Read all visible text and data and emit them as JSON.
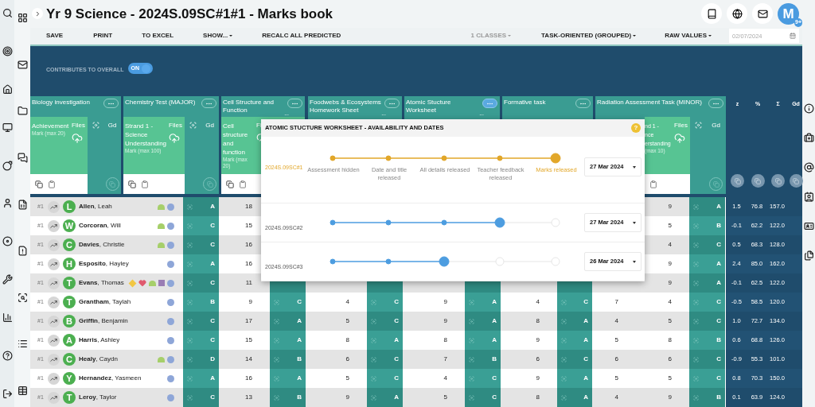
{
  "title": "Yr 9 Science - 2024S.09SC#1#1 - Marks book",
  "avatar": {
    "letter": "M",
    "badge": "9+"
  },
  "toolbar": {
    "actions": [
      {
        "label": "SAVE",
        "kind": "button"
      },
      {
        "label": "PRINT",
        "kind": "button"
      },
      {
        "label": "TO EXCEL",
        "kind": "button"
      },
      {
        "label": "SHOW...",
        "kind": "dropdown"
      },
      {
        "label": "RECALC ALL PREDICTED",
        "kind": "button"
      }
    ],
    "options": [
      {
        "label": "1 CLASSES",
        "disabled": true
      },
      {
        "label": "TASK-ORIENTED (GROUPED)",
        "disabled": false
      },
      {
        "label": "RAW VALUES",
        "disabled": false
      }
    ],
    "date_field": "02/07/2024"
  },
  "contributes": {
    "label": "CONTRIBUTES TO OVERALL",
    "toggle": "ON",
    "on": true
  },
  "tasks": [
    {
      "title": "Biology investigation",
      "menu_selected": false,
      "sub": {
        "strand": "Achievement",
        "max": "Mark (max 20)",
        "files": "Files",
        "grade": "Gd"
      }
    },
    {
      "title": "Chemistry Test (MAJOR)",
      "menu_selected": false,
      "sub": {
        "strand": "Strand 1 - Science Understanding",
        "max": "Mark (max 100)",
        "files": "Files",
        "grade": "Gd"
      }
    },
    {
      "title": "Cell Structure and Function",
      "more": "...",
      "menu_selected": false,
      "sub": {
        "strand": "Cell structure and function",
        "max": "Mark (max 20)",
        "files": "Fi"
      }
    },
    {
      "title": "Foodwebs & Ecosystems Homework Sheet",
      "more": "...",
      "menu_selected": false
    },
    {
      "title": "Atomic Stucture Worksheet",
      "more": "...",
      "menu_selected": true
    },
    {
      "title": "Formative task",
      "menu_selected": false
    },
    {
      "title": "Radiation Assessment Task (MINOR)",
      "menu_selected": false,
      "sub": {
        "cut": true,
        "strand": "nd 1 -\nnce\nerstanding",
        "max": "(max 10)",
        "files": "Files",
        "grade": "Gd"
      }
    }
  ],
  "summary_headers": [
    "z",
    "%",
    "Σ",
    "Gd"
  ],
  "body_columns": [
    {
      "kind": "grade"
    },
    {
      "kind": "mark"
    },
    {
      "kind": "grade"
    },
    {
      "kind": "mark"
    },
    {
      "kind": "grade"
    },
    {
      "kind": "mark"
    },
    {
      "kind": "grade"
    },
    {
      "kind": "mark"
    },
    {
      "kind": "grade"
    },
    {
      "kind": "mark"
    },
    {
      "kind": "mark"
    },
    {
      "kind": "grade"
    }
  ],
  "students": [
    {
      "rank": "#1",
      "initial": "L",
      "name": "**Allen**, Leah",
      "tags": [
        {
          "kind": "pill",
          "color": "#a6cf6a"
        },
        {
          "kind": "dot",
          "color": "#8ea6d8"
        }
      ],
      "cells": [
        "A",
        "18",
        null,
        null,
        null,
        null,
        null,
        null,
        null,
        null,
        "9",
        "A"
      ],
      "summary": [
        "1.5",
        "76.8",
        "157.0"
      ]
    },
    {
      "rank": "#1",
      "initial": "W",
      "name": "**Corcoran**, Will",
      "tags": [
        {
          "kind": "pill",
          "color": "#a6cf6a"
        },
        {
          "kind": "dot",
          "color": "#8ea6d8"
        }
      ],
      "cells": [
        "C",
        "15",
        null,
        null,
        null,
        null,
        null,
        null,
        null,
        null,
        "5",
        "B"
      ],
      "summary": [
        "-0.1",
        "62.2",
        "122.0"
      ]
    },
    {
      "rank": "#1",
      "initial": "C",
      "name": "**Davies**, Christie",
      "tags": [
        {
          "kind": "pill",
          "color": "#a6cf6a"
        },
        {
          "kind": "dot",
          "color": "#8ea6d8"
        }
      ],
      "cells": [
        "C",
        "16",
        null,
        null,
        null,
        null,
        null,
        null,
        null,
        null,
        "4",
        "C"
      ],
      "summary": [
        "0.5",
        "68.3",
        "128.0"
      ]
    },
    {
      "rank": "#1",
      "initial": "H",
      "name": "**Esposito**, Hayley",
      "tags": [
        {
          "kind": "dot",
          "color": "#8ea6d8"
        }
      ],
      "cells": [
        "A",
        "16",
        null,
        null,
        null,
        null,
        null,
        null,
        null,
        null,
        "9",
        "A"
      ],
      "summary": [
        "2.4",
        "85.0",
        "162.0"
      ]
    },
    {
      "rank": "#1",
      "initial": "T",
      "name": "**Evans**, Thomas",
      "tags": [
        {
          "kind": "diamond",
          "color": "#f2c744"
        },
        {
          "kind": "heart",
          "color": "#e05a6e"
        },
        {
          "kind": "pill",
          "color": "#a6cf6a"
        },
        {
          "kind": "square",
          "color": "#9a7db4"
        },
        {
          "kind": "dot",
          "color": "#8ea6d8"
        }
      ],
      "cells": [
        "C",
        "11",
        null,
        null,
        null,
        null,
        null,
        null,
        null,
        null,
        "9",
        "A"
      ],
      "summary": [
        "-0.1",
        "62.5",
        "122.0"
      ]
    },
    {
      "rank": "#1",
      "initial": "T",
      "name": "**Grantham**, Taylah",
      "tags": [
        {
          "kind": "dot",
          "color": "#8ea6d8"
        }
      ],
      "cells": [
        "B",
        "9",
        "C",
        "4",
        "C",
        "9",
        "A",
        "4",
        "C",
        "7",
        "4",
        "C"
      ],
      "summary": [
        "-0.5",
        "58.5",
        "120.0"
      ]
    },
    {
      "rank": "#1",
      "initial": "B",
      "name": "**Griffin**, Benjamin",
      "tags": [
        {
          "kind": "dot",
          "color": "#8ea6d8"
        }
      ],
      "cells": [
        "C",
        "17",
        "A",
        "5",
        "C",
        "9",
        "A",
        "8",
        "A",
        "4",
        "5",
        "C"
      ],
      "summary": [
        "1.0",
        "72.7",
        "134.0"
      ]
    },
    {
      "rank": "#1",
      "initial": "A",
      "name": "**Harris**, Ashley",
      "tags": [
        {
          "kind": "dot",
          "color": "#8ea6d8"
        }
      ],
      "cells": [
        "C",
        "15",
        "A",
        "8",
        "A",
        "8",
        "A",
        "9",
        "A",
        "5",
        "8",
        "B"
      ],
      "summary": [
        "0.6",
        "68.8",
        "126.0"
      ]
    },
    {
      "rank": "#1",
      "initial": "C",
      "name": "**Healy**, Caydn",
      "tags": [
        {
          "kind": "pill",
          "color": "#a6cf6a"
        },
        {
          "kind": "dot",
          "color": "#8ea6d8"
        }
      ],
      "cells": [
        "D",
        "14",
        "B",
        "6",
        "C",
        "7",
        "B",
        "6",
        "C",
        "6",
        "6",
        "C"
      ],
      "summary": [
        "-0.9",
        "55.3",
        "101.0"
      ]
    },
    {
      "rank": "#1",
      "initial": "Y",
      "name": "**Hernandez**, Yasmeen",
      "tags": [
        {
          "kind": "dot",
          "color": "#8ea6d8"
        }
      ],
      "cells": [
        "A",
        "16",
        "A",
        "5",
        "C",
        "4",
        "C",
        "9",
        "A",
        "5",
        "5",
        "C"
      ],
      "summary": [
        "0.8",
        "70.3",
        "150.0"
      ]
    },
    {
      "rank": "#1",
      "initial": "T",
      "name": "**Leroy**, Taylor",
      "tags": [
        {
          "kind": "dot",
          "color": "#8ea6d8"
        }
      ],
      "cells": [
        "C",
        "13",
        "B",
        "9",
        "A",
        "5",
        "C",
        "8",
        "A",
        "4",
        "9",
        "B"
      ],
      "summary": [
        "0.1",
        "63.9",
        "124.0"
      ]
    }
  ],
  "popover": {
    "title": "ATOMIC STUCTURE WORKSHEET - AVAILABILITY AND DATES",
    "help": "?",
    "stages": [
      "Assessment hidden",
      "Date and title released",
      "All details released",
      "Teacher feedback released",
      "Marks released"
    ],
    "classes": [
      {
        "name": "2024S.09SC#1",
        "selected": true,
        "date": "27 Mar 2024",
        "steps": [
          {
            "done": true,
            "current": false
          },
          {
            "done": true,
            "current": false
          },
          {
            "done": true,
            "current": false
          },
          {
            "done": true,
            "current": false
          },
          {
            "done": true,
            "current": true
          }
        ]
      },
      {
        "name": "2024S.09SC#2",
        "selected": false,
        "date": "27 Mar 2024",
        "steps": [
          {
            "done": true,
            "current": false
          },
          {
            "done": true,
            "current": false
          },
          {
            "done": true,
            "current": false
          },
          {
            "done": true,
            "current": true
          },
          {
            "done": false,
            "current": false
          }
        ]
      },
      {
        "name": "2024S.09SC#3",
        "selected": false,
        "date": "26 Mar 2024",
        "steps": [
          {
            "done": true,
            "current": false
          },
          {
            "done": true,
            "current": false
          },
          {
            "done": true,
            "current": true
          },
          {
            "done": false,
            "current": false
          },
          {
            "done": false,
            "current": false
          }
        ]
      }
    ]
  }
}
